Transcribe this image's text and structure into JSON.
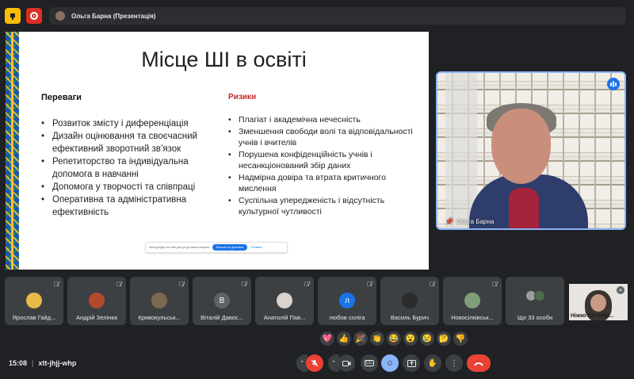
{
  "presenter_chip": {
    "label": "Ольга Барна (Презентація)"
  },
  "slide": {
    "title": "Місце ШІ в освіті",
    "benefits_heading": "Переваги",
    "risks_heading": "Ризики",
    "benefits": [
      "Розвиток змісту і диференціація",
      "Дизайн оцінювання та своєчасний ефективний зворотний зв’язок",
      "Репетиторство та індивідуальна допомога в навчанні",
      "Допомога у творчості та співпраці",
      "Оперативна та адміністративна ефективність"
    ],
    "risks": [
      "Плагіат і академічна нечесність",
      "Зменшення свободи волі та відповідальності учнів і вчителів",
      "Порушена конфіденційність учнів і несанкціонований збір даних",
      "Надмірна довіра та втрата критичного мислення",
      "Суспільна упередженість і відсутність культурної чутливості"
    ],
    "share_bar": {
      "text": "meet.google.com має доступ до вашого екрана",
      "stop_label": "Більше не ділитися",
      "hide_label": "Сховати"
    }
  },
  "speaker": {
    "name": "Ольга Барна"
  },
  "participants": [
    {
      "name": "Ярослав Гайд...",
      "avatar_color": "#e9b949",
      "initial": ""
    },
    {
      "name": "Андрій Зелінка",
      "avatar_color": "#b44a2c",
      "initial": ""
    },
    {
      "name": "Кривокульськ...",
      "avatar_color": "#7a6a4e",
      "initial": ""
    },
    {
      "name": "Віталій Давос...",
      "avatar_color": "#5f6368",
      "initial": "В"
    },
    {
      "name": "Анатолій Пав...",
      "avatar_color": "#d9d4cf",
      "initial": ""
    },
    {
      "name": "любов соліга",
      "avatar_color": "#1a73e8",
      "initial": "л"
    },
    {
      "name": "Василь Бурич",
      "avatar_color": "#2b2b2b",
      "initial": ""
    },
    {
      "name": "Новосілківськ...",
      "avatar_color": "#7f9e7a",
      "initial": ""
    }
  ],
  "more_participants": {
    "label": "Ще 33 особи"
  },
  "self_view": {
    "name": "Ніжко Наталія..."
  },
  "reactions": [
    "💖",
    "👍",
    "🎉",
    "👏",
    "😂",
    "😮",
    "😢",
    "🤔",
    "👎"
  ],
  "bottom": {
    "time": "15:08",
    "meeting_code": "xtt-jhjj-whp"
  },
  "colors": {
    "accent": "#8ab4f8",
    "danger": "#ea4335",
    "tile": "#3c4043"
  }
}
